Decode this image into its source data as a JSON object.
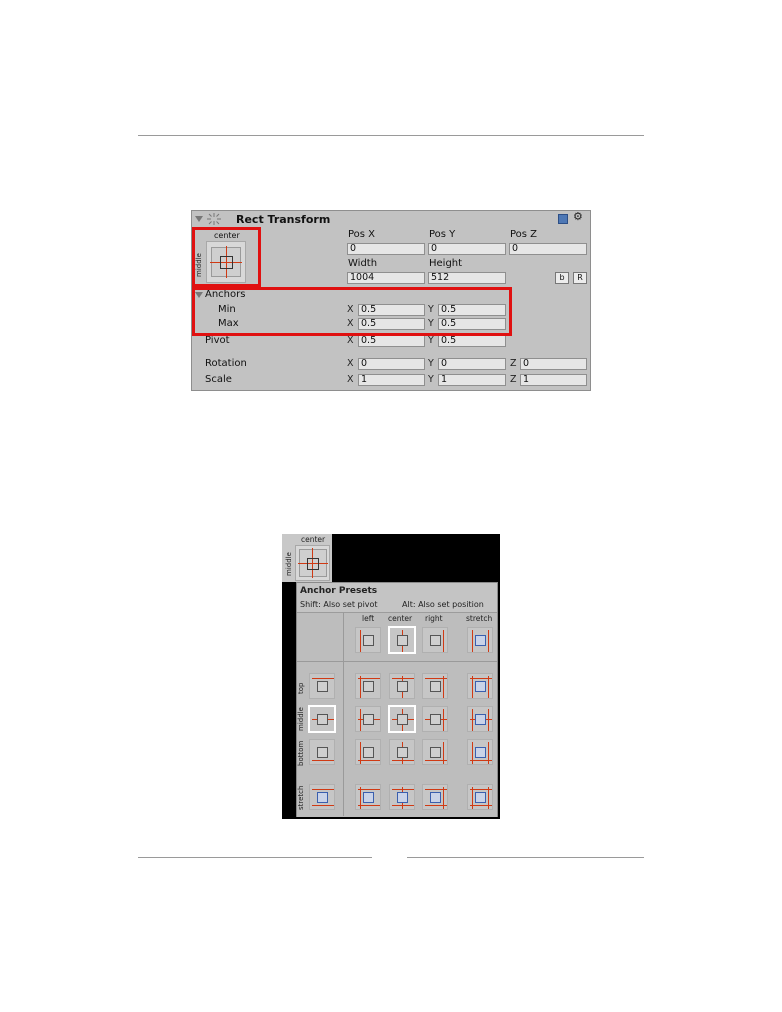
{
  "inspector": {
    "title": "Rect Transform",
    "anchor_widget": {
      "horizontal": "center",
      "vertical": "middle"
    },
    "labels": {
      "pos_x": "Pos X",
      "pos_y": "Pos Y",
      "pos_z": "Pos Z",
      "width": "Width",
      "height": "Height"
    },
    "values": {
      "pos_x": "0",
      "pos_y": "0",
      "pos_z": "0",
      "width": "1004",
      "height": "512"
    },
    "buttons": {
      "blueprint": "b",
      "raw": "R"
    },
    "anchors": {
      "label": "Anchors",
      "min_label": "Min",
      "max_label": "Max",
      "min_x": "0.5",
      "min_y": "0.5",
      "max_x": "0.5",
      "max_y": "0.5"
    },
    "pivot": {
      "label": "Pivot",
      "x": "0.5",
      "y": "0.5"
    },
    "rotation": {
      "label": "Rotation",
      "x": "0",
      "y": "0",
      "z": "0"
    },
    "scale": {
      "label": "Scale",
      "x": "1",
      "y": "1",
      "z": "1"
    },
    "axes": {
      "x": "X",
      "y": "Y",
      "z": "Z"
    }
  },
  "presets": {
    "widget": {
      "horizontal": "center",
      "vertical": "middle"
    },
    "title": "Anchor Presets",
    "hint_shift": "Shift: Also set pivot",
    "hint_alt": "Alt: Also set position",
    "columns": [
      "left",
      "center",
      "right",
      "stretch"
    ],
    "rows": [
      "top",
      "middle",
      "bottom",
      "stretch"
    ],
    "selected": {
      "row": "middle",
      "column": "center"
    }
  },
  "colors": {
    "highlight": "#e01010",
    "anchor_line": "#d03a14",
    "panel_bg": "#c2c2c2",
    "stretch_blue": "#3a5fae"
  }
}
